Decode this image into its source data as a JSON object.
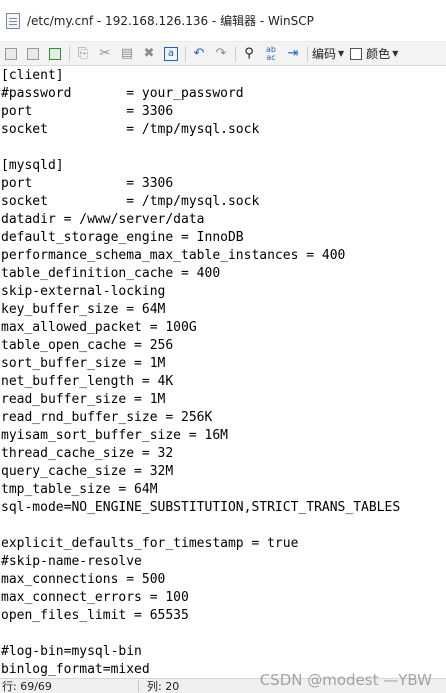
{
  "window": {
    "title": "/etc/my.cnf - 192.168.126.136 - 编辑器 - WinSCP"
  },
  "toolbar": {
    "buttons": [
      {
        "name": "save-icon",
        "glyph": ""
      },
      {
        "name": "save-all-icon",
        "glyph": ""
      },
      {
        "name": "reload-icon",
        "glyph": ""
      },
      {
        "name": "copy-icon",
        "glyph": "⎘"
      },
      {
        "name": "cut-icon",
        "glyph": "✂"
      },
      {
        "name": "paste-icon",
        "glyph": "📋"
      },
      {
        "name": "delete-icon",
        "glyph": "✖"
      },
      {
        "name": "select-all-icon",
        "glyph": "a"
      },
      {
        "name": "undo-icon",
        "glyph": "↶"
      },
      {
        "name": "redo-icon",
        "glyph": "↷"
      },
      {
        "name": "find-icon",
        "glyph": "⌕"
      },
      {
        "name": "replace-icon",
        "glyph": "ab"
      },
      {
        "name": "goto-line-icon",
        "glyph": "⇥"
      }
    ],
    "encoding_label": "编码",
    "color_label": "颜色"
  },
  "editor": {
    "lines": [
      "[client]",
      "#password       = your_password",
      "port            = 3306",
      "socket          = /tmp/mysql.sock",
      "",
      "[mysqld]",
      "port            = 3306",
      "socket          = /tmp/mysql.sock",
      "datadir = /www/server/data",
      "default_storage_engine = InnoDB",
      "performance_schema_max_table_instances = 400",
      "table_definition_cache = 400",
      "skip-external-locking",
      "key_buffer_size = 64M",
      "max_allowed_packet = 100G",
      "table_open_cache = 256",
      "sort_buffer_size = 1M",
      "net_buffer_length = 4K",
      "read_buffer_size = 1M",
      "read_rnd_buffer_size = 256K",
      "myisam_sort_buffer_size = 16M",
      "thread_cache_size = 32",
      "query_cache_size = 32M",
      "tmp_table_size = 64M",
      "sql-mode=NO_ENGINE_SUBSTITUTION,STRICT_TRANS_TABLES",
      "",
      "explicit_defaults_for_timestamp = true",
      "#skip-name-resolve",
      "max_connections = 500",
      "max_connect_errors = 100",
      "open_files_limit = 65535",
      "",
      "#log-bin=mysql-bin",
      "binlog_format=mixed"
    ]
  },
  "status": {
    "line": "行: 69/69",
    "column": "列: 20"
  },
  "watermark": "CSDN @modest —YBW"
}
